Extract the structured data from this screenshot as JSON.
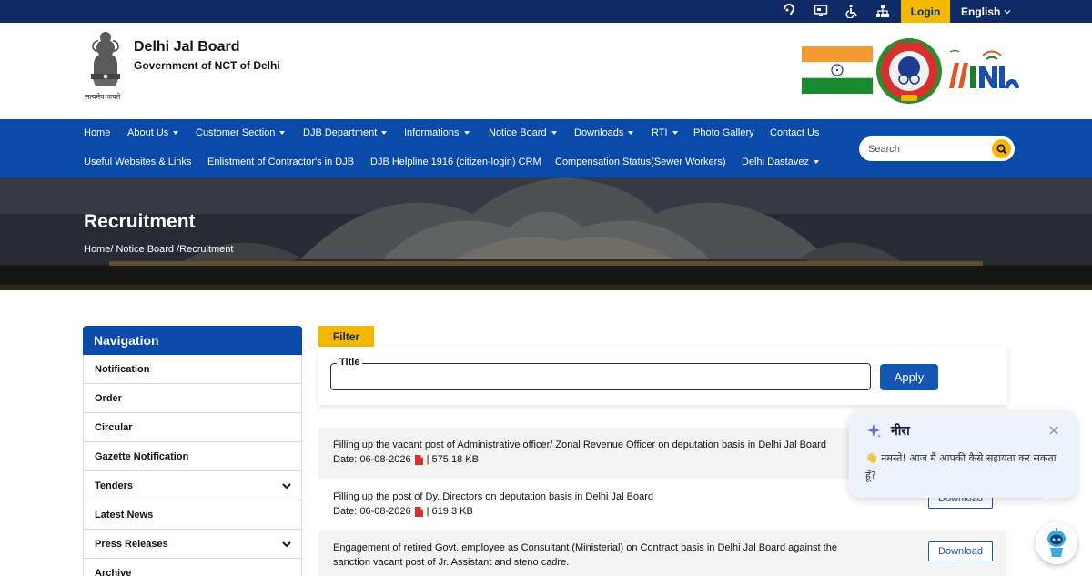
{
  "topbar": {
    "icons": [
      "screen-reader-icon",
      "monitor-icon",
      "accessibility-icon",
      "sitemap-icon"
    ],
    "login_label": "Login",
    "language": "English"
  },
  "header": {
    "org_name": "Delhi Jal Board",
    "org_sub": "Government of NCT of Delhi",
    "emblem_motto": "सत्यमेव जयते",
    "logos": [
      "india-flag",
      "cyber-dost-logo",
      "digital-india-logo"
    ]
  },
  "nav": {
    "row1": [
      {
        "label": "Home",
        "dropdown": false
      },
      {
        "label": "About Us",
        "dropdown": true
      },
      {
        "label": "Customer Section",
        "dropdown": true
      },
      {
        "label": "DJB Department",
        "dropdown": true
      },
      {
        "label": "Informations",
        "dropdown": true
      },
      {
        "label": "Notice Board",
        "dropdown": true
      },
      {
        "label": "Downloads",
        "dropdown": true
      },
      {
        "label": "RTI",
        "dropdown": true
      },
      {
        "label": "Photo Gallery",
        "dropdown": false
      },
      {
        "label": "Contact Us",
        "dropdown": false
      }
    ],
    "row2": [
      {
        "label": "Useful Websites & Links",
        "dropdown": false
      },
      {
        "label": "Enlistment of Contractor's in DJB",
        "dropdown": false
      },
      {
        "label": "DJB Helpline 1916 (citizen-login) CRM",
        "dropdown": false
      },
      {
        "label": "Compensation Status(Sewer Workers)",
        "dropdown": false
      },
      {
        "label": "Delhi Dastavez",
        "dropdown": true
      }
    ],
    "search_placeholder": "Search"
  },
  "hero": {
    "title": "Recruitment",
    "breadcrumb": "Home/ Notice Board /Recruitment"
  },
  "sidebar": {
    "heading": "Navigation",
    "items": [
      {
        "label": "Notification",
        "expandable": false
      },
      {
        "label": "Order",
        "expandable": false
      },
      {
        "label": "Circular",
        "expandable": false
      },
      {
        "label": "Gazette Notification",
        "expandable": false
      },
      {
        "label": "Tenders",
        "expandable": true
      },
      {
        "label": "Latest News",
        "expandable": false
      },
      {
        "label": "Press Releases",
        "expandable": true
      },
      {
        "label": "Archive",
        "expandable": false
      }
    ]
  },
  "filter": {
    "tab_label": "Filter",
    "title_label": "Title",
    "title_value": "",
    "apply_label": "Apply"
  },
  "records": [
    {
      "title": "Filling up the vacant post of Administrative officer/ Zonal Revenue Officer on deputation basis in Delhi Jal Board",
      "title2": "",
      "date": "Date: 06-08-2026",
      "size": "| 575.18 KB",
      "download": ""
    },
    {
      "title": "Filling up the post of Dy. Directors on deputation basis in Delhi Jal Board",
      "title2": "",
      "date": "Date: 06-08-2026",
      "size": "| 619.3 KB",
      "download": "Download"
    },
    {
      "title": "Engagement of retired Govt. employee as Consultant (Ministerial) on Contract basis in Delhi Jal Board against the",
      "title2": "sanction vacant post of Jr. Assistant and steno cadre.",
      "date": "",
      "size": "",
      "download": "Download"
    }
  ],
  "chat": {
    "name": "नीरा",
    "message": "👋 नमस्ते! आज मैं आपकी कैसे सहायता कर सकता हूँ?"
  },
  "colors": {
    "topbar": "#0f2b66",
    "nav": "#0a4aa8",
    "accent": "#f5b800",
    "button": "#1557b0"
  }
}
